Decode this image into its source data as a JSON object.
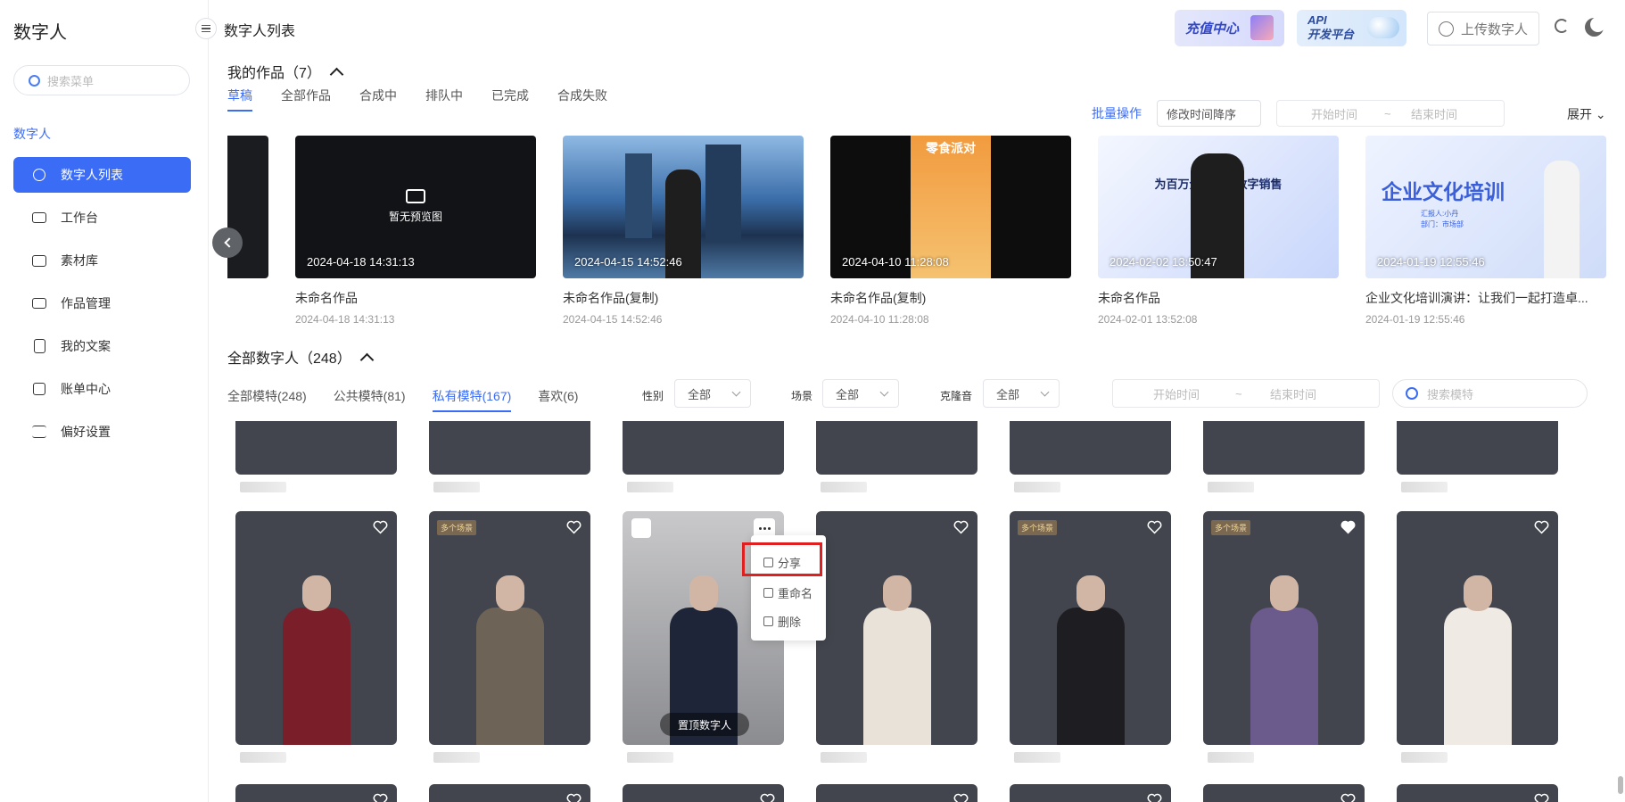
{
  "app": {
    "title": "数字人",
    "search_placeholder": "搜索菜单",
    "group": "数字人"
  },
  "menu": [
    {
      "label": "数字人列表",
      "icon": "robot-icon",
      "active": true
    },
    {
      "label": "工作台",
      "icon": "monitor-icon"
    },
    {
      "label": "素材库",
      "icon": "folder-icon"
    },
    {
      "label": "作品管理",
      "icon": "video-icon"
    },
    {
      "label": "我的文案",
      "icon": "document-icon"
    },
    {
      "label": "账单中心",
      "icon": "bill-icon"
    },
    {
      "label": "偏好设置",
      "icon": "sliders-icon"
    }
  ],
  "header": {
    "title": "数字人列表",
    "recharge": "充值中心",
    "api_line1": "API",
    "api_line2": "开发平台",
    "upload": "上传数字人"
  },
  "works": {
    "heading": "我的作品（7）",
    "tabs": [
      "草稿",
      "全部作品",
      "合成中",
      "排队中",
      "已完成",
      "合成失败"
    ],
    "active_tab": "草稿",
    "batch": "批量操作",
    "sort": "修改时间降序",
    "start_time": "开始时间",
    "end_time": "结束时间",
    "range_sep": "~",
    "expand": "展开",
    "no_preview": "暂无预览图",
    "items": [
      {
        "stamp": "2024-04-18 14:31:13",
        "name": "未命名作品",
        "date": "2024-04-18 14:31:13",
        "type": "none"
      },
      {
        "stamp": "2024-04-15 14:52:46",
        "name": "未命名作品(复制)",
        "date": "2024-04-15 14:52:46",
        "type": "city"
      },
      {
        "stamp": "2024-04-10 11:28:08",
        "name": "未命名作品(复制)",
        "date": "2024-04-10 11:28:08",
        "type": "snack",
        "poster": "零食派对"
      },
      {
        "stamp": "2024-02-02 13:50:47",
        "name": "未命名作品",
        "date": "2024-02-01 13:52:08",
        "type": "ai",
        "poster": "为百万企业提供数字销售"
      },
      {
        "stamp": "2024-01-19 12:55:46",
        "name": "企业文化培训演讲：让我们一起打造卓...",
        "date": "2024-01-19 12:55:46",
        "type": "culture",
        "poster": "企业文化培训",
        "poster_sub": "汇报人:小丹",
        "poster_sub2": "部门：市场部"
      }
    ]
  },
  "humans": {
    "heading": "全部数字人（248）",
    "tabs": [
      "全部模特(248)",
      "公共模特(81)",
      "私有模特(167)",
      "喜欢(6)"
    ],
    "active_tab": "私有模特(167)",
    "gender_label": "性别",
    "gender": "全部",
    "scene_label": "场景",
    "scene": "全部",
    "voice_label": "克隆音",
    "voice": "全部",
    "start_time": "开始时间",
    "end_time": "结束时间",
    "range_sep": "~",
    "search_placeholder": "搜索模特",
    "badge": "多个场景",
    "pin_top": "置顶数字人",
    "menu": {
      "share": "分享",
      "rename": "重命名",
      "delete": "删除"
    }
  },
  "colors": {
    "accent": "#3b6cf5",
    "highlight": "#e02020"
  }
}
